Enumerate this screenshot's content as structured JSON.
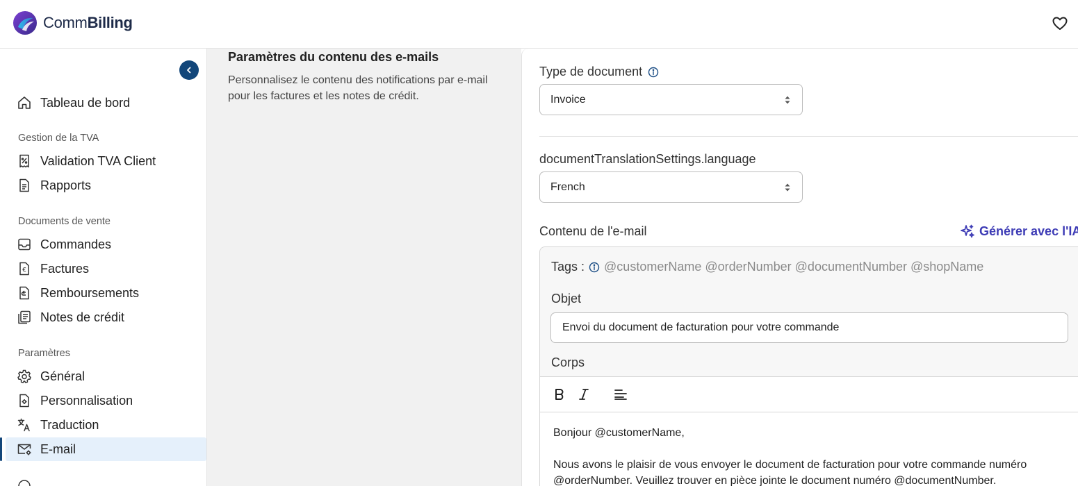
{
  "app": {
    "logo_part1": "Comm",
    "logo_part2": "Billing"
  },
  "sidebar": {
    "items": [
      {
        "label": "Tableau de bord",
        "icon": "home-icon"
      },
      {
        "label": "Validation TVA Client",
        "icon": "receipt-percent-icon"
      },
      {
        "label": "Rapports",
        "icon": "document-icon"
      },
      {
        "label": "Commandes",
        "icon": "inbox-icon"
      },
      {
        "label": "Factures",
        "icon": "euro-document-icon"
      },
      {
        "label": "Remboursements",
        "icon": "refund-icon"
      },
      {
        "label": "Notes de crédit",
        "icon": "stacked-documents-icon"
      },
      {
        "label": "Général",
        "icon": "gear-icon"
      },
      {
        "label": "Personnalisation",
        "icon": "customize-document-icon"
      },
      {
        "label": "Traduction",
        "icon": "translate-icon"
      },
      {
        "label": "E-mail",
        "icon": "email-gear-icon",
        "active": true
      }
    ],
    "sections": {
      "vat": "Gestion de la TVA",
      "sales": "Documents de vente",
      "settings": "Paramètres"
    }
  },
  "middle": {
    "title": "Paramètres du contenu des e-mails",
    "description": "Personnalisez le contenu des notifications par e-mail pour les factures et les notes de crédit."
  },
  "form": {
    "doc_type_label": "Type de document",
    "doc_type_value": "Invoice",
    "language_label": "documentTranslationSettings.language",
    "language_value": "French",
    "email_content_label": "Contenu de l'e-mail",
    "ai_button_label": "Générer avec l'IA",
    "tags_label": "Tags :",
    "tags_list": "@customerName @orderNumber @documentNumber @shopName",
    "subject_label": "Objet",
    "subject_value": "Envoi du document de facturation pour votre commande",
    "body_label": "Corps",
    "body_line1": "Bonjour @customerName,",
    "body_line2": "Nous avons le plaisir de vous envoyer le document de facturation pour votre commande numéro @orderNumber. Veuillez trouver en pièce jointe le document numéro @documentNumber."
  },
  "colors": {
    "primary": "#12467a",
    "active_bg": "#e5f0fb",
    "ai_accent": "#3d3bb5",
    "panel_bg": "#f1f1f1"
  }
}
